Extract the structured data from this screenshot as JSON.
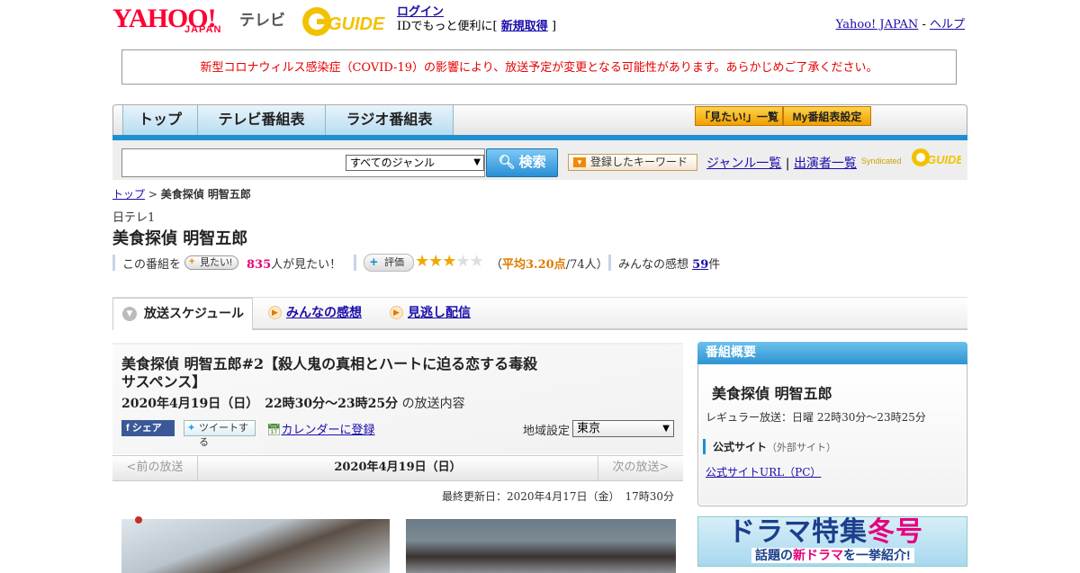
{
  "header": {
    "logo_text": "YAHOO!",
    "logo_japan": "JAPAN",
    "logo_tv": "テレビ",
    "gguide_label": "GUIDE",
    "login_link": "ログイン",
    "login_prefix": "IDでもっと便利に[",
    "signup_link": "新規取得",
    "login_suffix": "]",
    "yahoo_japan_link": "Yahoo! JAPAN",
    "separator": "-",
    "help_link": "ヘルプ"
  },
  "notice": "新型コロナウィルス感染症（COVID-19）の影響により、放送予定が変更となる可能性があります。あらかじめご了承ください。",
  "nav": {
    "tabs": [
      "トップ",
      "テレビ番組表",
      "ラジオ番組表"
    ],
    "mitai_list": "「見たい!」一覧",
    "my_settings": "My番組表設定"
  },
  "search": {
    "input_value": "",
    "genre": "すべてのジャンル",
    "button": "検索",
    "keyword_button": "登録したキーワード",
    "genre_list": "ジャンル一覧",
    "divider": "|",
    "cast_list": "出演者一覧",
    "syndicated": "Syndicated",
    "gguide": "GUIDE"
  },
  "breadcrumb": {
    "top": "トップ",
    "sep": ">",
    "current": "美食探偵 明智五郎"
  },
  "program": {
    "station": "日テレ1",
    "title": "美食探偵 明智五郎",
    "want_prefix": "この番組を",
    "want_button": "見たい!",
    "want_count": "835",
    "want_suffix": "人が見たい！",
    "rate_button": "評価",
    "rating_value": 3.2,
    "rating_open": "（",
    "rating_text": "平均3.20点",
    "rating_count": "/74人）",
    "comments_prefix": "みんなの感想",
    "comments_count": "59",
    "comments_suffix": "件"
  },
  "tabs": {
    "schedule": "放送スケジュール",
    "comments": "みんなの感想",
    "vod": "見逃し配信"
  },
  "episode": {
    "title": "美食探偵 明智五郎#2【殺人鬼の真相とハートに迫る恋する毒殺サスペンス】",
    "date": "2020年4月19日（日）　22時30分～23時25分",
    "date_suffix": "の放送内容",
    "share_fb": "シェア",
    "share_tw": "ツイートする",
    "calendar": "カレンダーに登録",
    "region_label": "地域設定",
    "region_value": "東京"
  },
  "pager": {
    "prev": "<前の放送",
    "date": "2020年4月19日（日）",
    "next": "次の放送>"
  },
  "updated": "最終更新日：2020年4月17日（金）　17時30分",
  "sidebar": {
    "header": "番組概要",
    "title": "美食探偵 明智五郎",
    "regular": "レギュラー放送：日曜 22時30分～23時25分",
    "official_label": "公式サイト",
    "official_note": "（外部サイト）",
    "official_url": "公式サイトURL（PC）"
  },
  "banner": {
    "main": "ドラマ特集",
    "main_accent": "冬号",
    "sub_a": "話題の",
    "sub_b": "新ドラマ",
    "sub_c": "を一挙紹介!"
  },
  "colors": {
    "yahoo_red": "#ff0033",
    "nav_blue": "#1f8fd0",
    "notice_red": "#e60000",
    "want_pink": "#e6007e",
    "rating_orange": "#e07a00"
  }
}
